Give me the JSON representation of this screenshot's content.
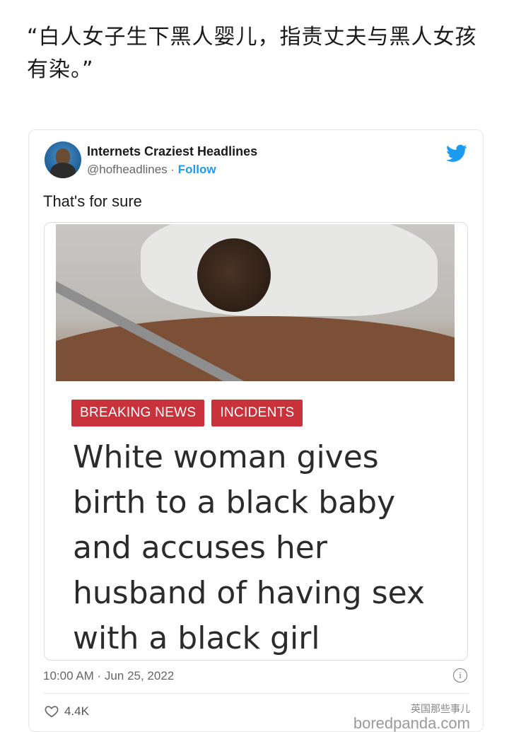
{
  "caption": "“白人女子生下黑人婴儿，指责丈夫与黑人女孩有染。”",
  "tweet": {
    "user_name": "Internets Craziest Headlines",
    "handle": "@hofheadlines",
    "separator": " · ",
    "follow_label": "Follow",
    "text": "That's for sure",
    "timestamp": "10:00 AM · Jun 25, 2022",
    "like_count": "4.4K",
    "brand_color": "#1d9bf0"
  },
  "article": {
    "tags": [
      "BREAKING NEWS",
      "INCIDENTS"
    ],
    "tag_color": "#c9323a",
    "headline": "White woman gives birth to a black baby and accuses her husband of having sex with a black girl"
  },
  "watermark": {
    "top": "英国那些事儿",
    "bottom": "boredpanda.com"
  },
  "icons": [
    "avatar",
    "twitter-bird-icon",
    "info-icon",
    "heart-icon"
  ]
}
